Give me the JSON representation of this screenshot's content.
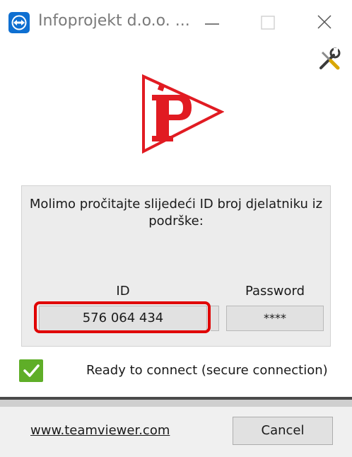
{
  "window": {
    "title": "Infoprojekt d.o.o. ...",
    "app_icon": "teamviewer-icon",
    "controls": [
      "minimize-icon",
      "maximize-icon",
      "close-icon"
    ]
  },
  "toolbar": {
    "tools_icon": "tools-icon"
  },
  "logo": {
    "icon": "infoprojekt-logo",
    "colors": {
      "red": "#e11b22"
    }
  },
  "instructions": {
    "text": "Molimo pročitajte slijedeći ID broj djelatniku iz podrške:"
  },
  "credentials": {
    "id_label": "ID",
    "id_value": "576 064 434",
    "password_label": "Password",
    "password_value": "****",
    "highlight_color": "#e00000"
  },
  "status": {
    "icon": "check-icon",
    "text": "Ready to connect (secure connection)",
    "color": "#5fae28"
  },
  "footer": {
    "website_link": "www.teamviewer.com",
    "cancel_label": "Cancel"
  }
}
